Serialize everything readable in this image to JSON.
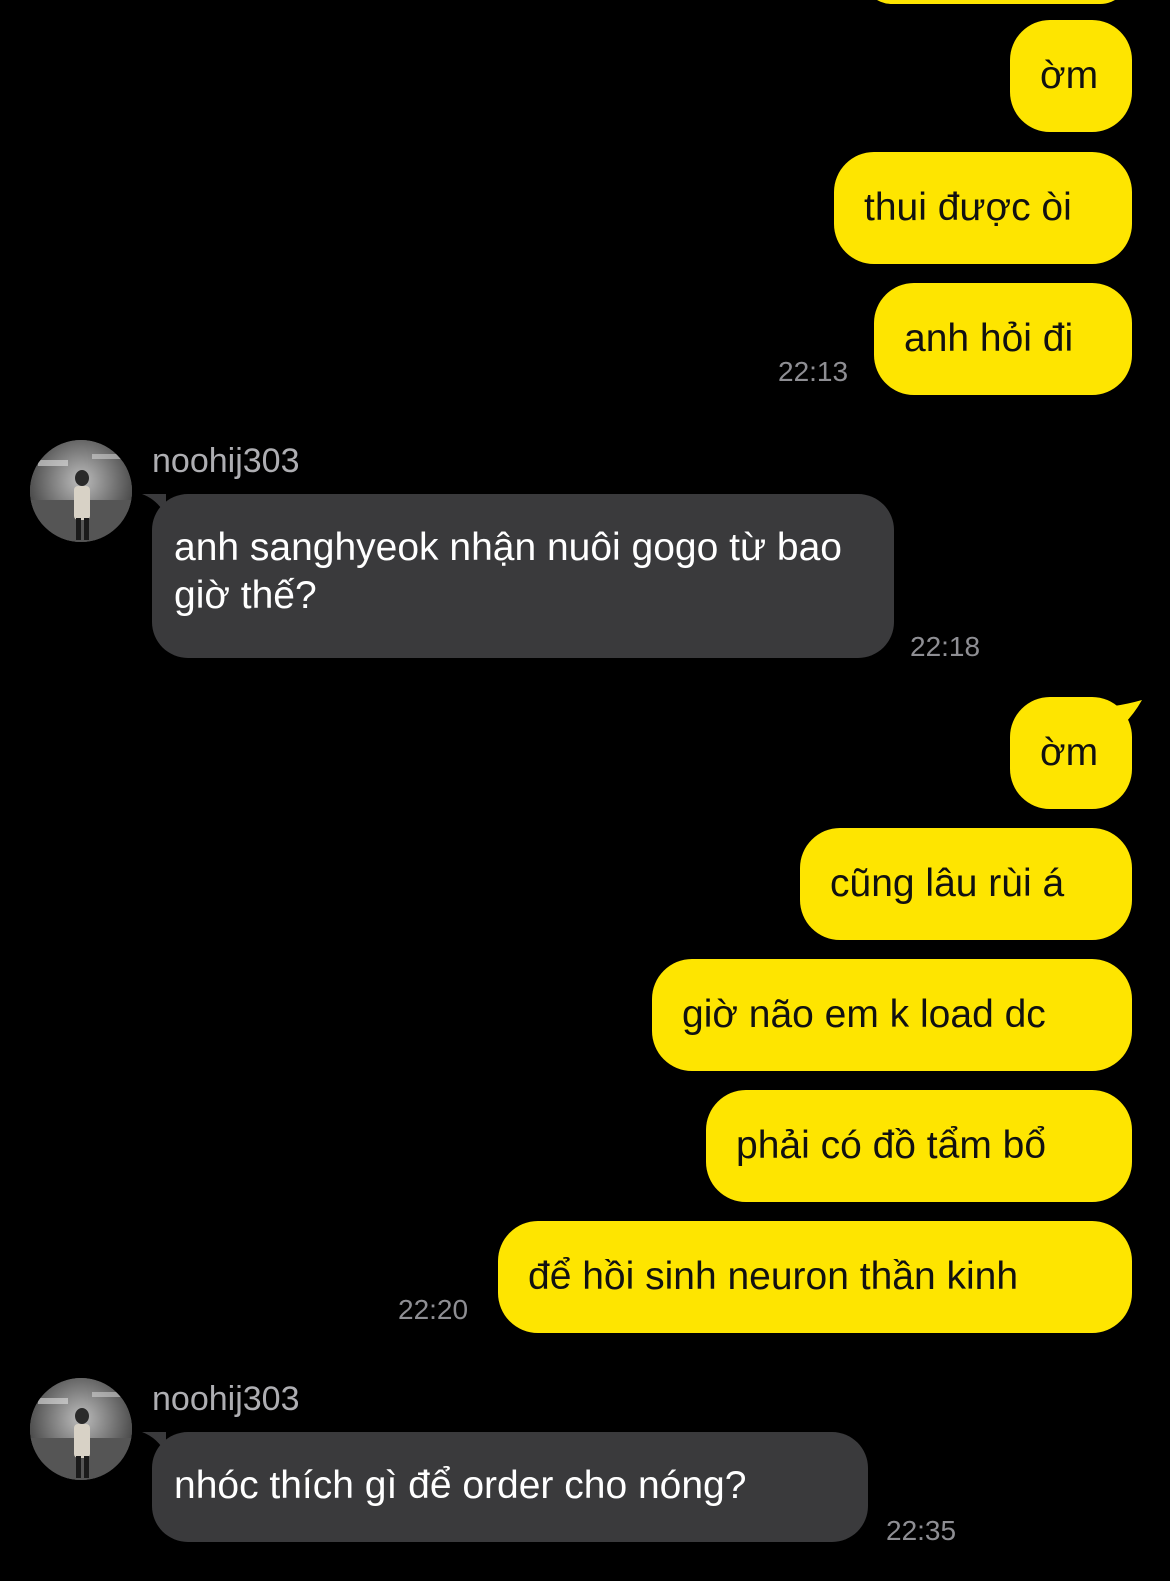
{
  "colors": {
    "background": "#000000",
    "my_bubble": "#FEE500",
    "their_bubble": "#3A3A3C",
    "timestamp": "#8E8E93",
    "sender_name": "#AEAEB2"
  },
  "messages": [
    {
      "side": "me",
      "text": "ờm"
    },
    {
      "side": "me",
      "text": "thui được òi"
    },
    {
      "side": "me",
      "text": "anh hỏi đi",
      "time": "22:13"
    },
    {
      "side": "them",
      "sender": "noohij303",
      "text": "anh sanghyeok nhận nuôi gogo từ bao giờ thế?",
      "time": "22:18"
    },
    {
      "side": "me",
      "text": "ờm"
    },
    {
      "side": "me",
      "text": "cũng lâu rùi á"
    },
    {
      "side": "me",
      "text": "giờ não em k load dc"
    },
    {
      "side": "me",
      "text": "phải có đồ tẩm bổ"
    },
    {
      "side": "me",
      "text": "để hồi sinh neuron thần kinh",
      "time": "22:20"
    },
    {
      "side": "them",
      "sender": "noohij303",
      "text": "nhóc thích gì để order cho nóng?",
      "time": "22:35"
    }
  ]
}
